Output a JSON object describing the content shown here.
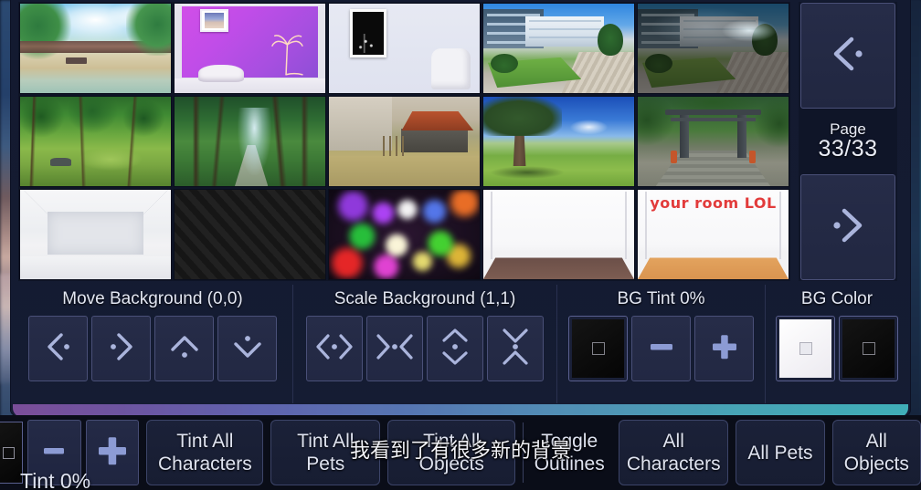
{
  "page_nav": {
    "prev_label": "prev-page",
    "next_label": "next-page",
    "page_title": "Page",
    "page_value": "33/33"
  },
  "controls": {
    "move": {
      "title": "Move Background (0,0)",
      "buttons": [
        "move-left",
        "move-right",
        "move-up",
        "move-down"
      ]
    },
    "scale": {
      "title": "Scale Background (1,1)",
      "buttons": [
        "scale-wider",
        "scale-narrower",
        "scale-taller",
        "scale-shorter"
      ]
    },
    "bg_tint": {
      "title": "BG Tint 0%",
      "minus": "−",
      "plus": "+"
    },
    "bg_color": {
      "title": "BG Color",
      "swatches": [
        "white",
        "black"
      ]
    }
  },
  "bottom_bar": {
    "tint_readout": "Tint 0%",
    "minus": "−",
    "plus": "+",
    "tint_all_characters": "Tint All\nCharacters",
    "tint_all_pets_line1": "Tint All",
    "tint_all_pets_line2": "Pets",
    "tint_all_objects_line1": "Tint All",
    "tint_all_objects_line2": "Objects",
    "toggle_outlines_line1": "Toggle",
    "toggle_outlines_line2": "Outlines",
    "all_characters_line1": "All",
    "all_characters_line2": "Characters",
    "all_pets": "All Pets",
    "all_objects_line1": "All",
    "all_objects_line2": "Objects"
  },
  "overlay": {
    "caption": "我看到了有很多新的背景"
  },
  "thumbnails": [
    {
      "id": "riverside-park",
      "label": "riverside park daytime"
    },
    {
      "id": "purple-neon-room",
      "label": "purple room with palm neon sign"
    },
    {
      "id": "white-room-poster",
      "label": "white room with black poster and chair"
    },
    {
      "id": "school-courtyard-day",
      "label": "school courtyard day"
    },
    {
      "id": "school-courtyard-night",
      "label": "school courtyard night"
    },
    {
      "id": "forest-clearing",
      "label": "sunny forest clearing"
    },
    {
      "id": "forest-path",
      "label": "misty forest path"
    },
    {
      "id": "country-house",
      "label": "country house red roof"
    },
    {
      "id": "great-tree-field",
      "label": "great tree in field"
    },
    {
      "id": "shrine-torii",
      "label": "shrine torii gate path"
    },
    {
      "id": "empty-white-room",
      "label": "empty white room"
    },
    {
      "id": "dark-stripes",
      "label": "dark diagonal stripes"
    },
    {
      "id": "bokeh-lights",
      "label": "colorful bokeh lights"
    },
    {
      "id": "room-brown-floor",
      "label": "white room brown floor"
    },
    {
      "id": "room-your-room",
      "label": "white room tan floor",
      "art_text": "your room LOL"
    }
  ]
}
